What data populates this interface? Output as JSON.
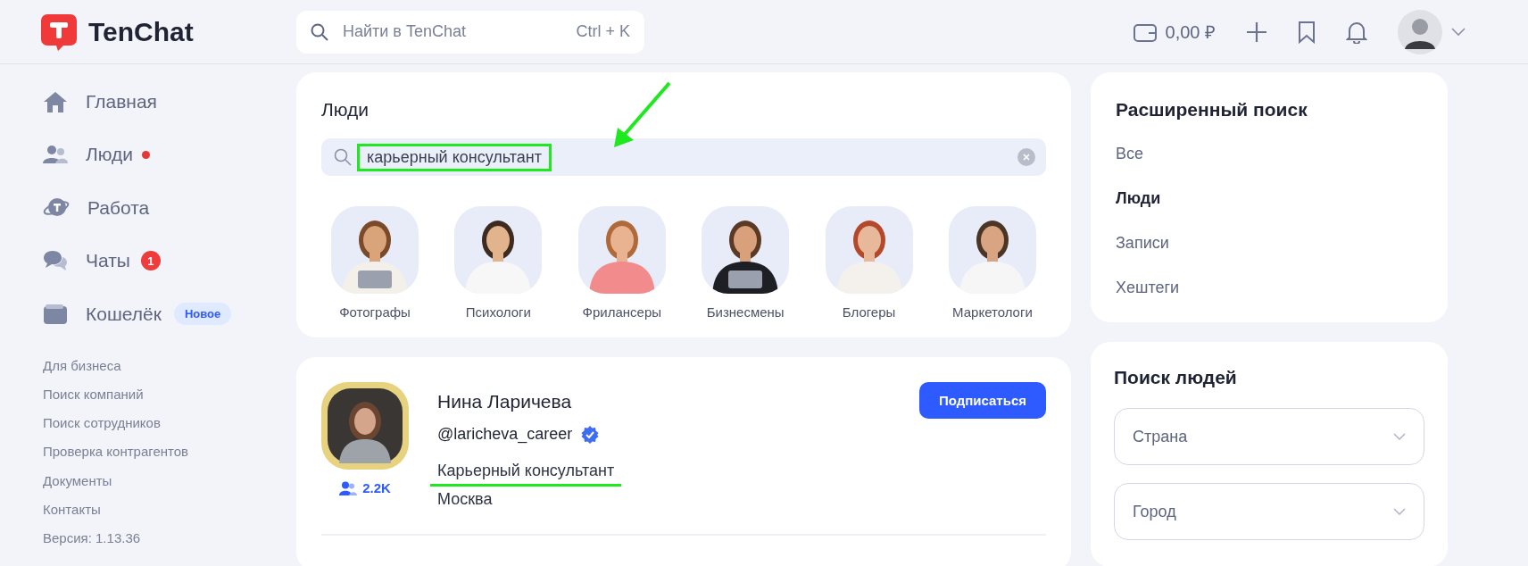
{
  "header": {
    "logo": "TenChat",
    "search": {
      "placeholder": "Найти в TenChat",
      "shortcut": "Ctrl + K"
    },
    "balance": "0,00 ₽"
  },
  "sidebar": {
    "items": [
      {
        "label": "Главная",
        "dot": false
      },
      {
        "label": "Люди",
        "dot": true
      },
      {
        "label": "Работа",
        "dot": false
      },
      {
        "label": "Чаты",
        "dot": false,
        "count": "1"
      },
      {
        "label": "Кошелёк",
        "dot": false,
        "tag": "Новое"
      }
    ],
    "links": [
      "Для бизнеса",
      "Поиск компаний",
      "Поиск сотрудников",
      "Проверка контрагентов",
      "Документы",
      "Контакты"
    ],
    "version": "Версия: 1.13.36"
  },
  "people_search": {
    "title": "Люди",
    "query": "карьерный консультант",
    "query_highlighted": true,
    "categories": [
      {
        "label": "Фотографы"
      },
      {
        "label": "Психологи"
      },
      {
        "label": "Фрилансеры"
      },
      {
        "label": "Бизнесмены"
      },
      {
        "label": "Блогеры"
      },
      {
        "label": "Маркетологи"
      }
    ]
  },
  "result": {
    "name": "Нина Ларичева",
    "handle": "@laricheva_career",
    "verified": true,
    "position": "Карьерный консультант",
    "position_underlined": true,
    "city": "Москва",
    "followers": "2.2K",
    "button": "Подписаться"
  },
  "advanced_search": {
    "title": "Расширенный поиск",
    "filters": [
      {
        "label": "Все",
        "selected": false
      },
      {
        "label": "Люди",
        "selected": true
      },
      {
        "label": "Записи",
        "selected": false
      },
      {
        "label": "Хештеги",
        "selected": false
      }
    ]
  },
  "people_filter": {
    "title": "Поиск людей",
    "dropdowns": [
      {
        "placeholder": "Страна"
      },
      {
        "placeholder": "Город"
      }
    ]
  }
}
